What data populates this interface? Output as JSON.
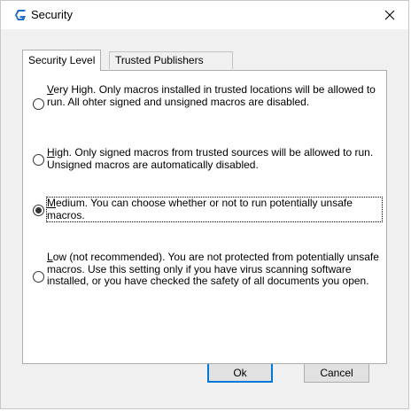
{
  "window": {
    "title": "Security",
    "logo_icon": "g-logo-icon",
    "close_icon": "close-icon",
    "accent_color": "#1f6fc9"
  },
  "tabs": [
    {
      "label": "Security Level",
      "active": true
    },
    {
      "label": "Trusted Publishers",
      "active": false
    }
  ],
  "options": [
    {
      "accelerator": "V",
      "text": "ery High. Only macros installed in trusted locations will be allowed to run. All ohter signed and unsigned macros are disabled.",
      "selected": false
    },
    {
      "accelerator": "H",
      "text": "igh. Only signed macros from trusted sources will be allowed to run. Unsigned macros are automatically disabled.",
      "selected": false
    },
    {
      "accelerator": "M",
      "text": "edium. You can choose whether or not to run potentially unsafe macros.",
      "selected": true
    },
    {
      "accelerator": "L",
      "text": "ow (not recommended). You are not protected from potentially unsafe macros. Use this setting only if you have virus scanning software installed, or you have checked the safety of all documents you open.",
      "selected": false
    }
  ],
  "buttons": {
    "ok_label": "Ok",
    "cancel_label": "Cancel"
  }
}
